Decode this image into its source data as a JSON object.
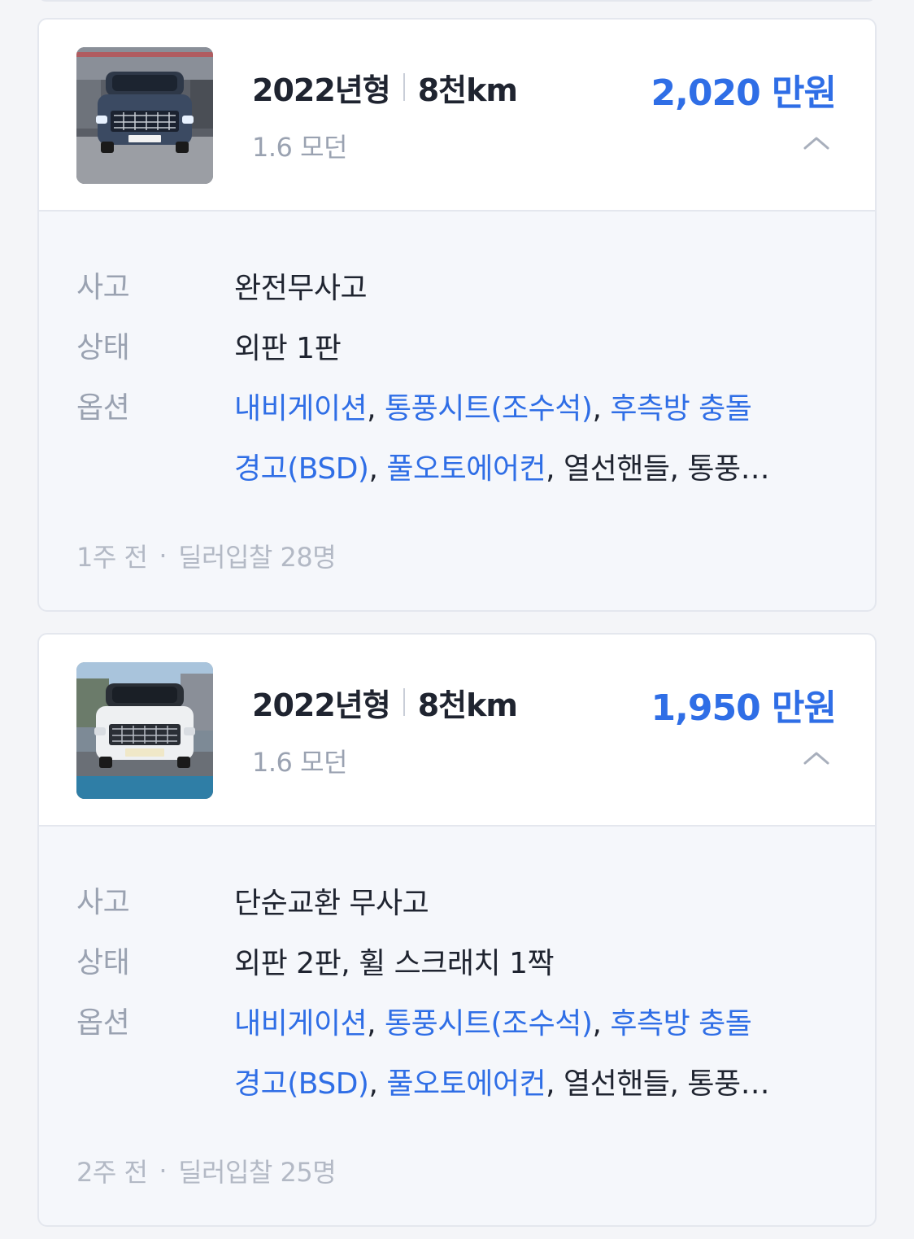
{
  "listings": [
    {
      "year": "2022년형",
      "mileage": "8천km",
      "trim": "1.6 모던",
      "price": "2,020 만원",
      "accident_label": "사고",
      "accident": "완전무사고",
      "condition_label": "상태",
      "condition": "외판 1판",
      "options_label": "옵션",
      "options_line1": [
        {
          "text": "내비게이션",
          "highlight": true
        },
        {
          "text": ", ",
          "highlight": false
        },
        {
          "text": "통풍시트(조수석)",
          "highlight": true
        },
        {
          "text": ", ",
          "highlight": false
        },
        {
          "text": "후측방 충돌",
          "highlight": true
        }
      ],
      "options_line2": [
        {
          "text": "경고(BSD)",
          "highlight": true
        },
        {
          "text": ", ",
          "highlight": false
        },
        {
          "text": "풀오토에어컨",
          "highlight": true
        },
        {
          "text": ", 열선핸들, 통풍…",
          "highlight": false
        }
      ],
      "posted": "1주 전",
      "bids": "딜러입찰 28명",
      "car_color": "#3b4a62"
    },
    {
      "year": "2022년형",
      "mileage": "8천km",
      "trim": "1.6 모던",
      "price": "1,950 만원",
      "accident_label": "사고",
      "accident": "단순교환 무사고",
      "condition_label": "상태",
      "condition": "외판 2판, 휠 스크래치 1짝",
      "options_label": "옵션",
      "options_line1": [
        {
          "text": "내비게이션",
          "highlight": true
        },
        {
          "text": ", ",
          "highlight": false
        },
        {
          "text": "통풍시트(조수석)",
          "highlight": true
        },
        {
          "text": ", ",
          "highlight": false
        },
        {
          "text": "후측방 충돌",
          "highlight": true
        }
      ],
      "options_line2": [
        {
          "text": "경고(BSD)",
          "highlight": true
        },
        {
          "text": ", ",
          "highlight": false
        },
        {
          "text": "풀오토에어컨",
          "highlight": true
        },
        {
          "text": ", 열선핸들, 통풍…",
          "highlight": false
        }
      ],
      "posted": "2주 전",
      "bids": "딜러입찰 25명",
      "car_color": "#eef0f2"
    }
  ],
  "icons": {
    "collapse": "chevron-up-icon"
  },
  "colors": {
    "price": "#2f6ee6",
    "option_highlight": "#2f6ee6",
    "muted": "#9aa2b1"
  }
}
